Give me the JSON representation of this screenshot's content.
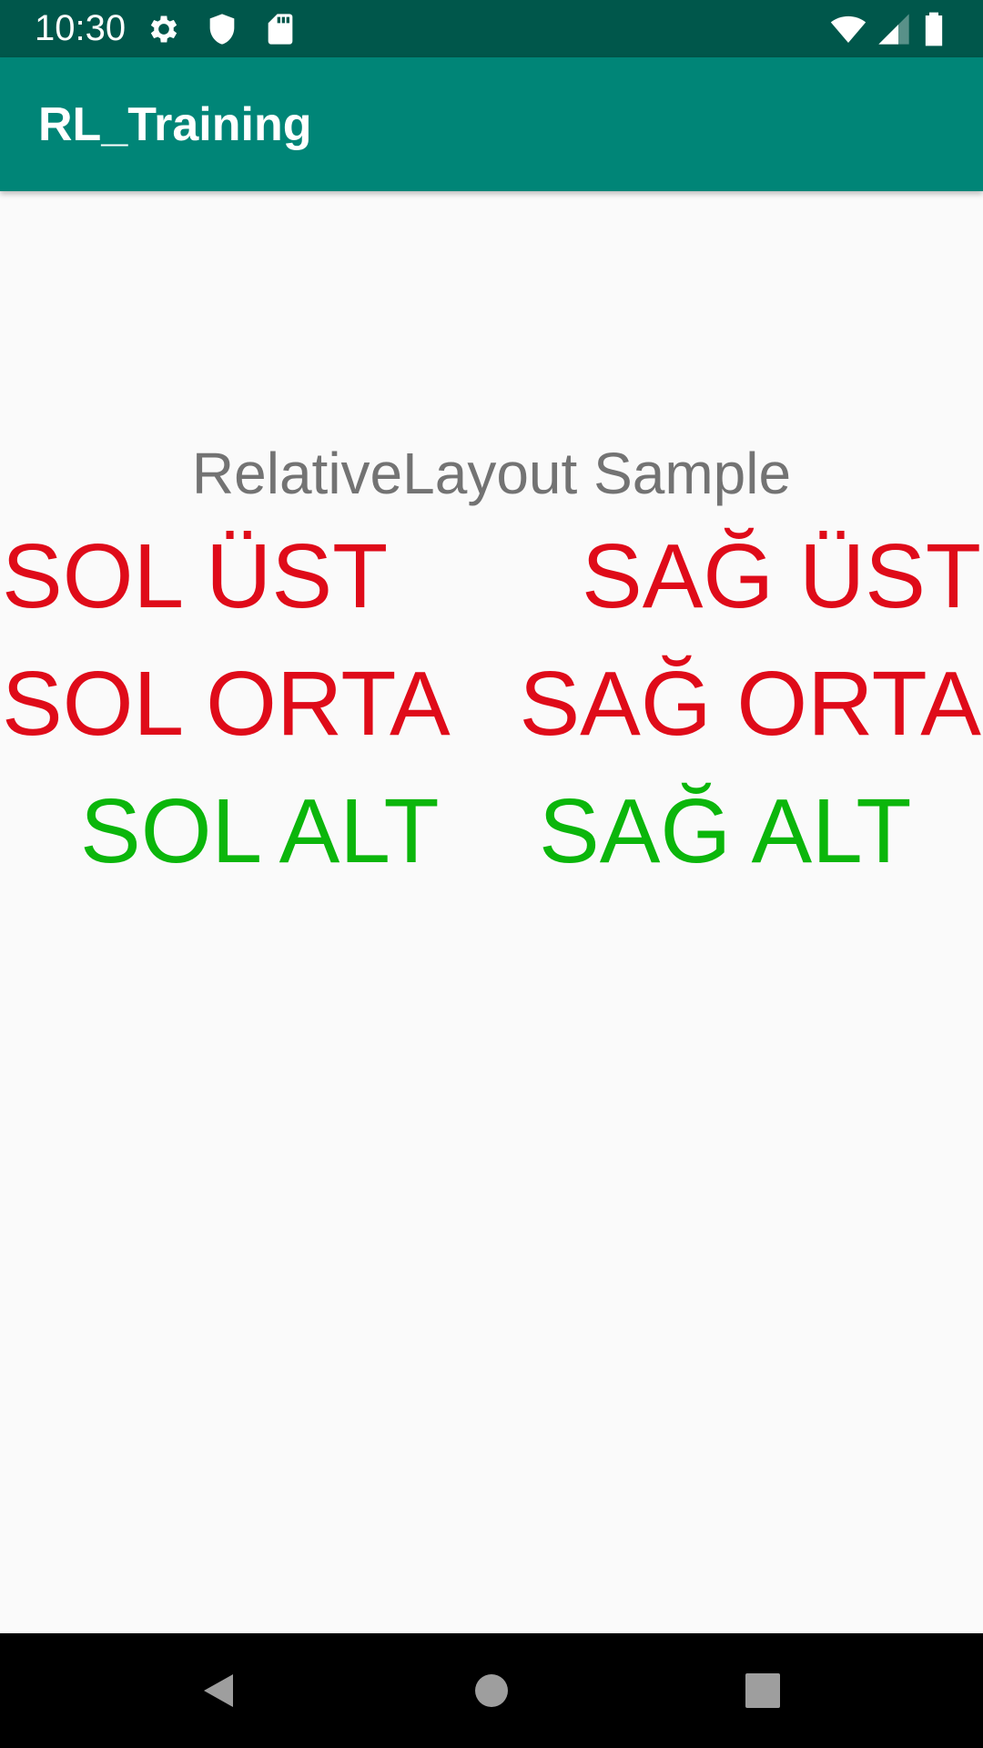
{
  "status_bar": {
    "time": "10:30",
    "left_icons": [
      "gear-icon",
      "shield-icon",
      "sd-card-icon"
    ],
    "right_icons": [
      "wifi-icon",
      "cell-signal-icon",
      "battery-icon"
    ]
  },
  "app_bar": {
    "title": "RL_Training",
    "color": "#008577"
  },
  "content": {
    "heading": "RelativeLayout Sample",
    "labels": {
      "top_left": "SOL ÜST",
      "top_right": "SAĞ ÜST",
      "middle_left": "SOL ORTA",
      "middle_right": "SAĞ ORTA",
      "bottom_left": "SOL ALT",
      "bottom_right": "SAĞ ALT"
    },
    "colors": {
      "red": "#df0b19",
      "green": "#0bb60b",
      "heading": "#737373"
    }
  },
  "nav_bar": {
    "buttons": [
      "back-icon",
      "home-icon",
      "recents-icon"
    ]
  }
}
